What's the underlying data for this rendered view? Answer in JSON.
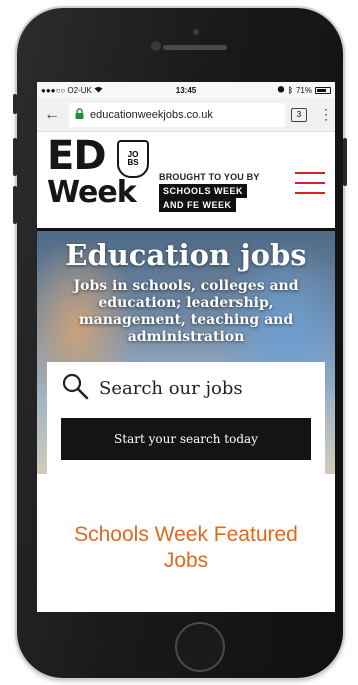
{
  "status_bar": {
    "carrier": "●●●○○ O2-UK",
    "wifi_icon": "wifi-icon",
    "time": "13:45",
    "alarm_icon": "alarm-icon",
    "bluetooth_icon": "bluetooth-icon",
    "battery_percent": "71%"
  },
  "browser": {
    "url": "educationweekjobs.co.uk",
    "tab_count": "3",
    "back_icon": "back-arrow-icon",
    "lock_icon": "lock-icon",
    "menu_icon": "more-vertical-icon"
  },
  "site_header": {
    "logo_ed": "ED",
    "logo_week": "Week",
    "logo_badge_lines": [
      "JO",
      "BS"
    ],
    "brought_to_you_by": "BROUGHT TO YOU BY",
    "partner_1": "SCHOOLS WEEK",
    "partner_2": "AND FE WEEK",
    "menu_color": "#e02020"
  },
  "hero": {
    "title": "Education jobs",
    "subtitle": "Jobs in schools, colleges and education; leadership, management, teaching and administration",
    "search_label": "Search our jobs",
    "search_button": "Start your search today"
  },
  "featured": {
    "title": "Schools Week Featured Jobs",
    "accent_color": "#e0691f"
  }
}
